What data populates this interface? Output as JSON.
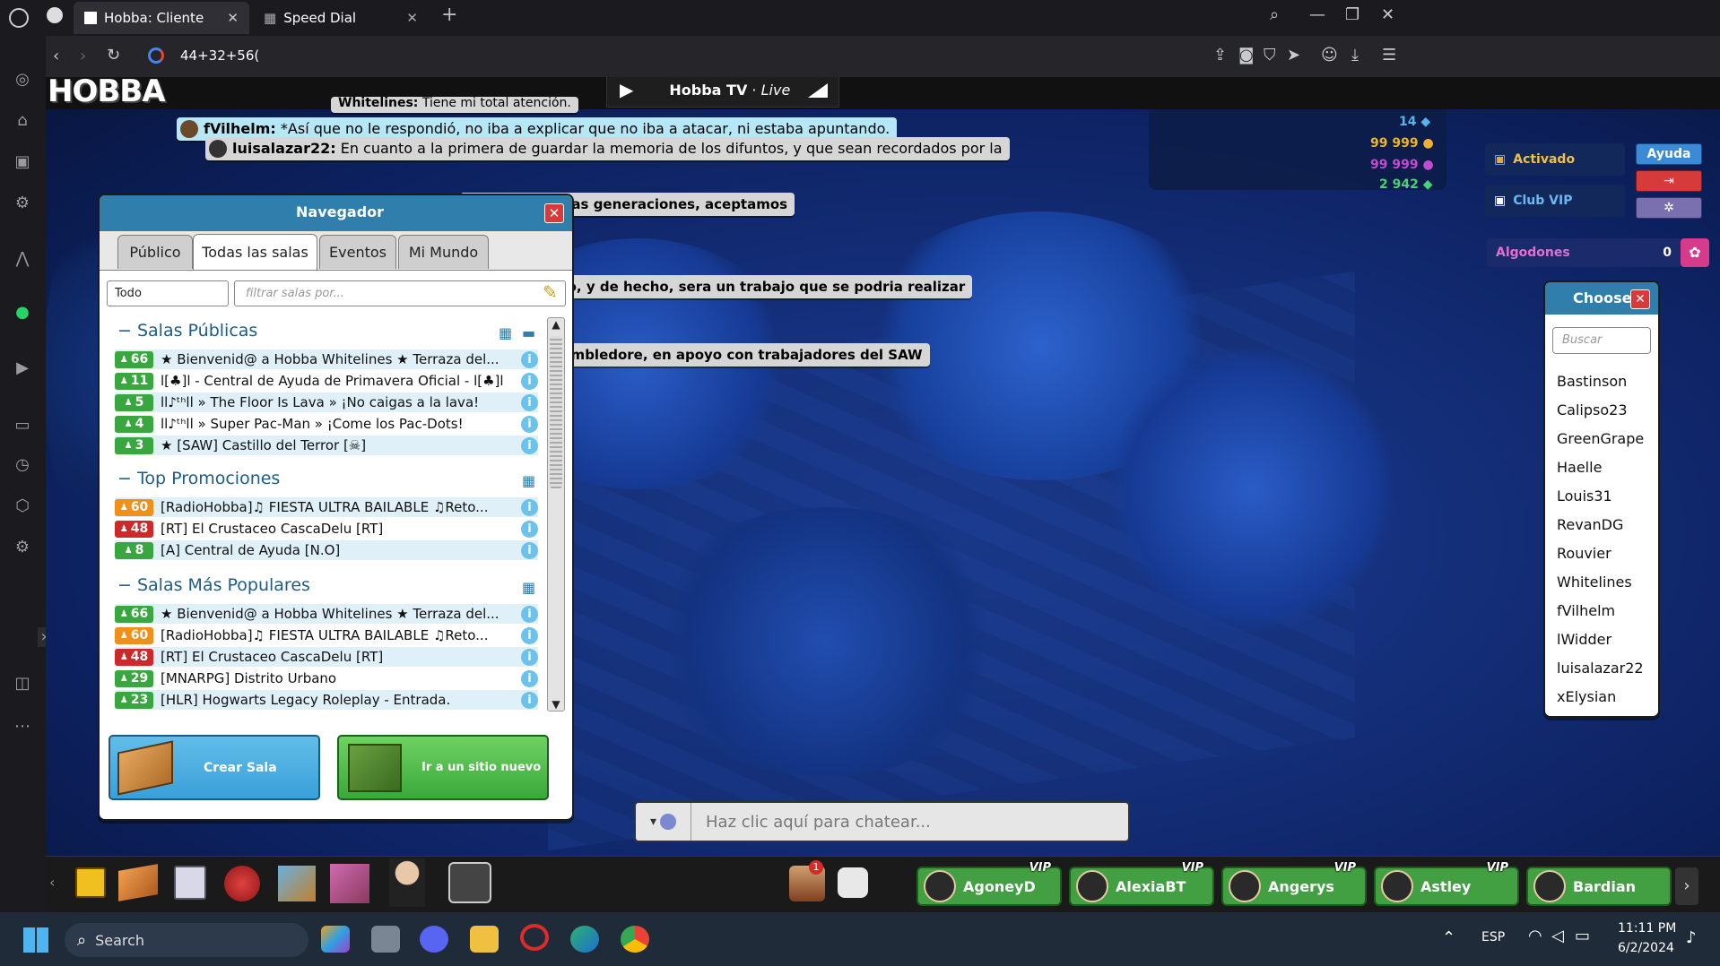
{
  "browser": {
    "tabs": [
      {
        "title": "Hobba: Cliente",
        "active": true
      },
      {
        "title": "Speed Dial",
        "active": false
      }
    ],
    "new_tab": "+",
    "address": "44+32+56("
  },
  "header": {
    "logo": "HOBBA",
    "tv_title": "Hobba TV",
    "tv_sep": " · ",
    "tv_live": "Live"
  },
  "chat_bubbles": [
    {
      "user": "Whitelines:",
      "text": "Tiene mi total atención."
    },
    {
      "user": "fVilhelm:",
      "text": "*Así que no le respondió, no iba a explicar que no iba a atacar, ni estaba apuntando."
    },
    {
      "user": "luisalazar22:",
      "text": "En cuanto a la primera de guardar la memoria de los difuntos, y que sean recordados por la"
    },
    {
      "user": "",
      "text": "or las venideras generaciones, aceptamos"
    },
    {
      "user": "",
      "text": "n realizar esto, y de hecho, sera un trabajo que se podria realizar"
    },
    {
      "user": "",
      "text": "gica Albus Dumbledore, en apoyo con trabajadores del SAW"
    }
  ],
  "currency": [
    {
      "value": "14",
      "color": "#5ab4e6"
    },
    {
      "value": "99 999",
      "color": "#f0b030"
    },
    {
      "value": "99 999",
      "color": "#c24bd0"
    },
    {
      "value": "2 942",
      "color": "#4bd07a"
    }
  ],
  "status": {
    "activado": "Activado",
    "club_vip": "Club VIP",
    "ayuda": "Ayuda",
    "algodones": "Algodones",
    "algodones_count": "0"
  },
  "navigator": {
    "title": "Navegador",
    "tabs": [
      "Público",
      "Todas las salas",
      "Eventos",
      "Mi Mundo"
    ],
    "active_tab": "Todas las salas",
    "filter_select": "Todo",
    "search_placeholder": "filtrar salas por...",
    "sections": [
      {
        "name": "Salas Públicas",
        "rooms": [
          {
            "count": "66",
            "color": "g",
            "name": "★ Bienvenid@ a Hobba Whitelines ★ Terraza del..."
          },
          {
            "count": "11",
            "color": "g",
            "name": "l[♣]l - Central de Ayuda de Primavera Oficial - l[♣]l"
          },
          {
            "count": "5",
            "color": "g",
            "name": "ll♪ᵗʰll » The Floor Is Lava » ¡No caigas a la lava!"
          },
          {
            "count": "4",
            "color": "g",
            "name": "ll♪ᵗʰll » Super Pac-Man » ¡Come los Pac-Dots!"
          },
          {
            "count": "3",
            "color": "g",
            "name": "★ [SAW] Castillo del Terror [☠]"
          }
        ]
      },
      {
        "name": "Top Promociones",
        "rooms": [
          {
            "count": "60",
            "color": "o",
            "name": "[RadioHobba]♫ FIESTA ULTRA BAILABLE ♫Reto..."
          },
          {
            "count": "48",
            "color": "r",
            "name": "[RT] El Crustaceo CascaDelu [RT]"
          },
          {
            "count": "8",
            "color": "g",
            "name": "[A] Central de Ayuda [N.O]"
          }
        ]
      },
      {
        "name": "Salas Más Populares",
        "rooms": [
          {
            "count": "66",
            "color": "g",
            "name": "★ Bienvenid@ a Hobba Whitelines ★ Terraza del..."
          },
          {
            "count": "60",
            "color": "o",
            "name": "[RadioHobba]♫ FIESTA ULTRA BAILABLE ♫Reto..."
          },
          {
            "count": "48",
            "color": "r",
            "name": "[RT] El Crustaceo CascaDelu [RT]"
          },
          {
            "count": "29",
            "color": "g",
            "name": "[MNARPG] Distrito Urbano"
          },
          {
            "count": "23",
            "color": "g",
            "name": "[HLR] Hogwarts Legacy Roleplay - Entrada."
          }
        ]
      }
    ],
    "create_room": "Crear Sala",
    "go_random": "Ir a un sitio nuevo"
  },
  "chooser": {
    "title": "Chooser",
    "search_placeholder": "Buscar",
    "users": [
      "Bastinson",
      "Calipso23",
      "GreenGrape",
      "Haelle",
      "Louis31",
      "RevanDG",
      "Rouvier",
      "Whitelines",
      "fVilhelm",
      "lWidder",
      "luisalazar22",
      "xElysian"
    ]
  },
  "chat_input": {
    "placeholder": "Haz clic aquí para chatear..."
  },
  "friends": [
    {
      "name": "AgoneyD",
      "vip": "VIP"
    },
    {
      "name": "AlexiaBT",
      "vip": "VIP"
    },
    {
      "name": "Angerys",
      "vip": "VIP"
    },
    {
      "name": "Astley",
      "vip": "VIP"
    },
    {
      "name": "Bardian",
      "vip": ""
    }
  ],
  "notification_badge": "1",
  "taskbar": {
    "search": "Search",
    "lang": "ESP",
    "time": "11:11 PM",
    "date": "6/2/2024"
  }
}
